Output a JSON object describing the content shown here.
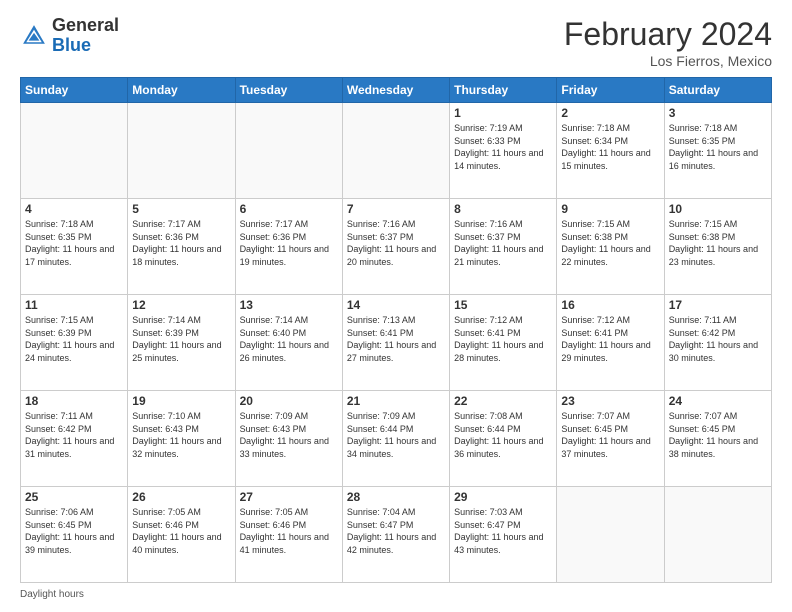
{
  "header": {
    "logo": {
      "line1": "General",
      "line2": "Blue"
    },
    "title": "February 2024",
    "subtitle": "Los Fierros, Mexico"
  },
  "days_of_week": [
    "Sunday",
    "Monday",
    "Tuesday",
    "Wednesday",
    "Thursday",
    "Friday",
    "Saturday"
  ],
  "weeks": [
    [
      {
        "day": "",
        "sunrise": "",
        "sunset": "",
        "daylight": "",
        "empty": true
      },
      {
        "day": "",
        "sunrise": "",
        "sunset": "",
        "daylight": "",
        "empty": true
      },
      {
        "day": "",
        "sunrise": "",
        "sunset": "",
        "daylight": "",
        "empty": true
      },
      {
        "day": "",
        "sunrise": "",
        "sunset": "",
        "daylight": "",
        "empty": true
      },
      {
        "day": "1",
        "sunrise": "7:19 AM",
        "sunset": "6:33 PM",
        "daylight": "11 hours and 14 minutes."
      },
      {
        "day": "2",
        "sunrise": "7:18 AM",
        "sunset": "6:34 PM",
        "daylight": "11 hours and 15 minutes."
      },
      {
        "day": "3",
        "sunrise": "7:18 AM",
        "sunset": "6:35 PM",
        "daylight": "11 hours and 16 minutes."
      }
    ],
    [
      {
        "day": "4",
        "sunrise": "7:18 AM",
        "sunset": "6:35 PM",
        "daylight": "11 hours and 17 minutes."
      },
      {
        "day": "5",
        "sunrise": "7:17 AM",
        "sunset": "6:36 PM",
        "daylight": "11 hours and 18 minutes."
      },
      {
        "day": "6",
        "sunrise": "7:17 AM",
        "sunset": "6:36 PM",
        "daylight": "11 hours and 19 minutes."
      },
      {
        "day": "7",
        "sunrise": "7:16 AM",
        "sunset": "6:37 PM",
        "daylight": "11 hours and 20 minutes."
      },
      {
        "day": "8",
        "sunrise": "7:16 AM",
        "sunset": "6:37 PM",
        "daylight": "11 hours and 21 minutes."
      },
      {
        "day": "9",
        "sunrise": "7:15 AM",
        "sunset": "6:38 PM",
        "daylight": "11 hours and 22 minutes."
      },
      {
        "day": "10",
        "sunrise": "7:15 AM",
        "sunset": "6:38 PM",
        "daylight": "11 hours and 23 minutes."
      }
    ],
    [
      {
        "day": "11",
        "sunrise": "7:15 AM",
        "sunset": "6:39 PM",
        "daylight": "11 hours and 24 minutes."
      },
      {
        "day": "12",
        "sunrise": "7:14 AM",
        "sunset": "6:39 PM",
        "daylight": "11 hours and 25 minutes."
      },
      {
        "day": "13",
        "sunrise": "7:14 AM",
        "sunset": "6:40 PM",
        "daylight": "11 hours and 26 minutes."
      },
      {
        "day": "14",
        "sunrise": "7:13 AM",
        "sunset": "6:41 PM",
        "daylight": "11 hours and 27 minutes."
      },
      {
        "day": "15",
        "sunrise": "7:12 AM",
        "sunset": "6:41 PM",
        "daylight": "11 hours and 28 minutes."
      },
      {
        "day": "16",
        "sunrise": "7:12 AM",
        "sunset": "6:41 PM",
        "daylight": "11 hours and 29 minutes."
      },
      {
        "day": "17",
        "sunrise": "7:11 AM",
        "sunset": "6:42 PM",
        "daylight": "11 hours and 30 minutes."
      }
    ],
    [
      {
        "day": "18",
        "sunrise": "7:11 AM",
        "sunset": "6:42 PM",
        "daylight": "11 hours and 31 minutes."
      },
      {
        "day": "19",
        "sunrise": "7:10 AM",
        "sunset": "6:43 PM",
        "daylight": "11 hours and 32 minutes."
      },
      {
        "day": "20",
        "sunrise": "7:09 AM",
        "sunset": "6:43 PM",
        "daylight": "11 hours and 33 minutes."
      },
      {
        "day": "21",
        "sunrise": "7:09 AM",
        "sunset": "6:44 PM",
        "daylight": "11 hours and 34 minutes."
      },
      {
        "day": "22",
        "sunrise": "7:08 AM",
        "sunset": "6:44 PM",
        "daylight": "11 hours and 36 minutes."
      },
      {
        "day": "23",
        "sunrise": "7:07 AM",
        "sunset": "6:45 PM",
        "daylight": "11 hours and 37 minutes."
      },
      {
        "day": "24",
        "sunrise": "7:07 AM",
        "sunset": "6:45 PM",
        "daylight": "11 hours and 38 minutes."
      }
    ],
    [
      {
        "day": "25",
        "sunrise": "7:06 AM",
        "sunset": "6:45 PM",
        "daylight": "11 hours and 39 minutes."
      },
      {
        "day": "26",
        "sunrise": "7:05 AM",
        "sunset": "6:46 PM",
        "daylight": "11 hours and 40 minutes."
      },
      {
        "day": "27",
        "sunrise": "7:05 AM",
        "sunset": "6:46 PM",
        "daylight": "11 hours and 41 minutes."
      },
      {
        "day": "28",
        "sunrise": "7:04 AM",
        "sunset": "6:47 PM",
        "daylight": "11 hours and 42 minutes."
      },
      {
        "day": "29",
        "sunrise": "7:03 AM",
        "sunset": "6:47 PM",
        "daylight": "11 hours and 43 minutes."
      },
      {
        "day": "",
        "sunrise": "",
        "sunset": "",
        "daylight": "",
        "empty": true
      },
      {
        "day": "",
        "sunrise": "",
        "sunset": "",
        "daylight": "",
        "empty": true
      }
    ]
  ],
  "footer": {
    "label": "Daylight hours"
  }
}
